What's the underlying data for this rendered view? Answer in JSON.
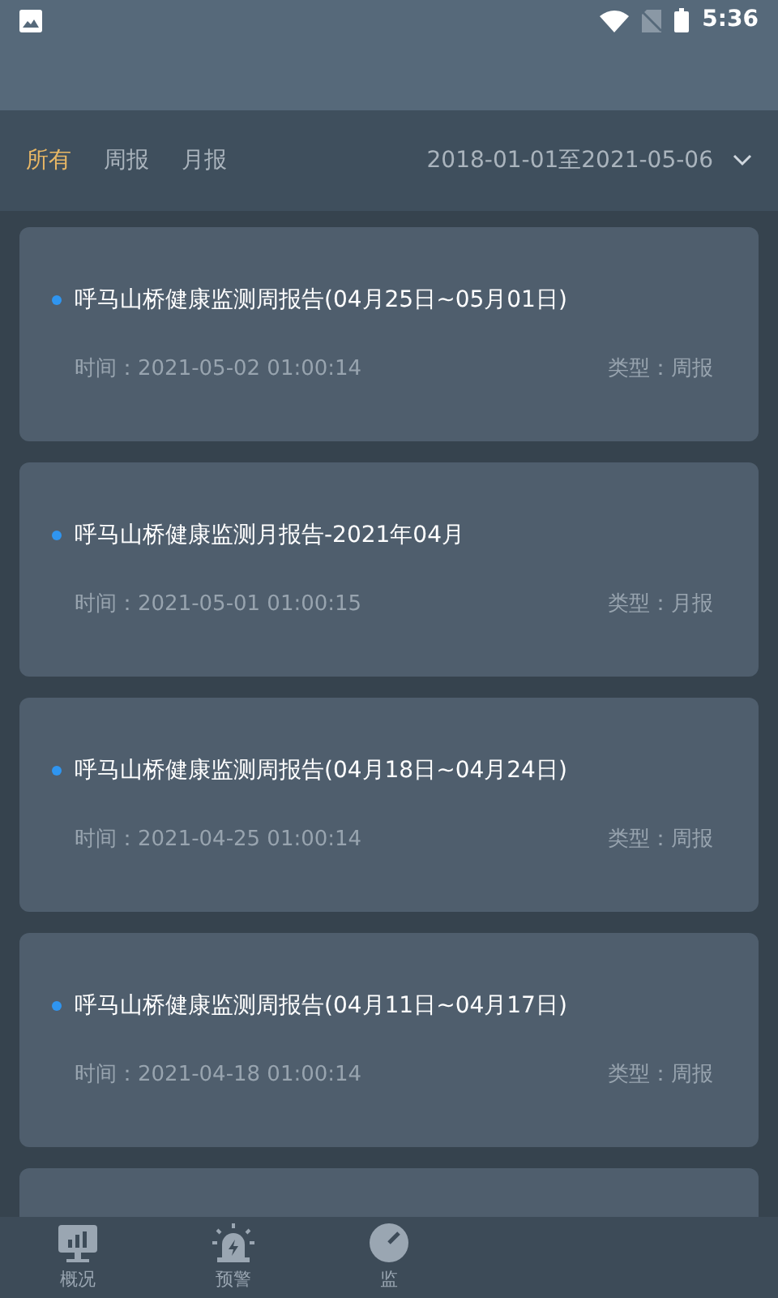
{
  "status_bar": {
    "time": "5:36"
  },
  "filter_tabs": [
    {
      "label": "所有",
      "selected": true
    },
    {
      "label": "周报",
      "selected": false
    },
    {
      "label": "月报",
      "selected": false
    }
  ],
  "date_range": "2018-01-01至2021-05-06",
  "reports": [
    {
      "title": "呼马山桥健康监测周报告(04月25日~05月01日)",
      "time": "时间：2021-05-02 01:00:14",
      "type": "类型：周报"
    },
    {
      "title": "呼马山桥健康监测月报告-2021年04月",
      "time": "时间：2021-05-01 01:00:15",
      "type": "类型：月报"
    },
    {
      "title": "呼马山桥健康监测周报告(04月18日~04月24日)",
      "time": "时间：2021-04-25 01:00:14",
      "type": "类型：周报"
    },
    {
      "title": "呼马山桥健康监测周报告(04月11日~04月17日)",
      "time": "时间：2021-04-18 01:00:14",
      "type": "类型：周报"
    }
  ],
  "bottom_nav": [
    {
      "label": "概况",
      "kind": "chart"
    },
    {
      "label": "预警",
      "kind": "alarm"
    },
    {
      "label": "监",
      "kind": "gauge"
    }
  ]
}
